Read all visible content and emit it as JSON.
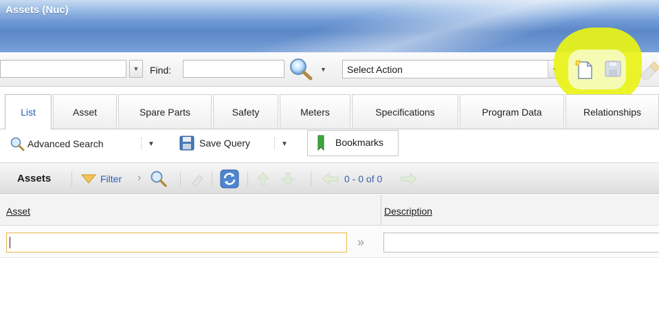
{
  "window": {
    "title": "Assets (Nuc)"
  },
  "toolbar": {
    "find_label": "Find:",
    "find_value": "",
    "select_action": "Select Action",
    "icons": [
      "search-icon",
      "new-record-icon",
      "save-icon",
      "clear-icon"
    ],
    "highlight_color": "#e8f318"
  },
  "tabs": [
    {
      "label": "List",
      "active": true
    },
    {
      "label": "Asset"
    },
    {
      "label": "Spare Parts"
    },
    {
      "label": "Safety"
    },
    {
      "label": "Meters"
    },
    {
      "label": "Specifications"
    },
    {
      "label": "Program Data"
    },
    {
      "label": "Relationships"
    }
  ],
  "listbar": {
    "advanced_search": "Advanced Search",
    "save_query": "Save Query",
    "bookmarks": "Bookmarks"
  },
  "table": {
    "title": "Assets",
    "filter_label": "Filter",
    "count": "0 - 0 of 0",
    "columns": [
      "Asset",
      "Description"
    ],
    "filter_values": {
      "asset": "",
      "description": ""
    }
  },
  "colors": {
    "accent": "#2a5fb5",
    "title_bar": "#5b87c8",
    "focus_border": "#e7b845"
  }
}
